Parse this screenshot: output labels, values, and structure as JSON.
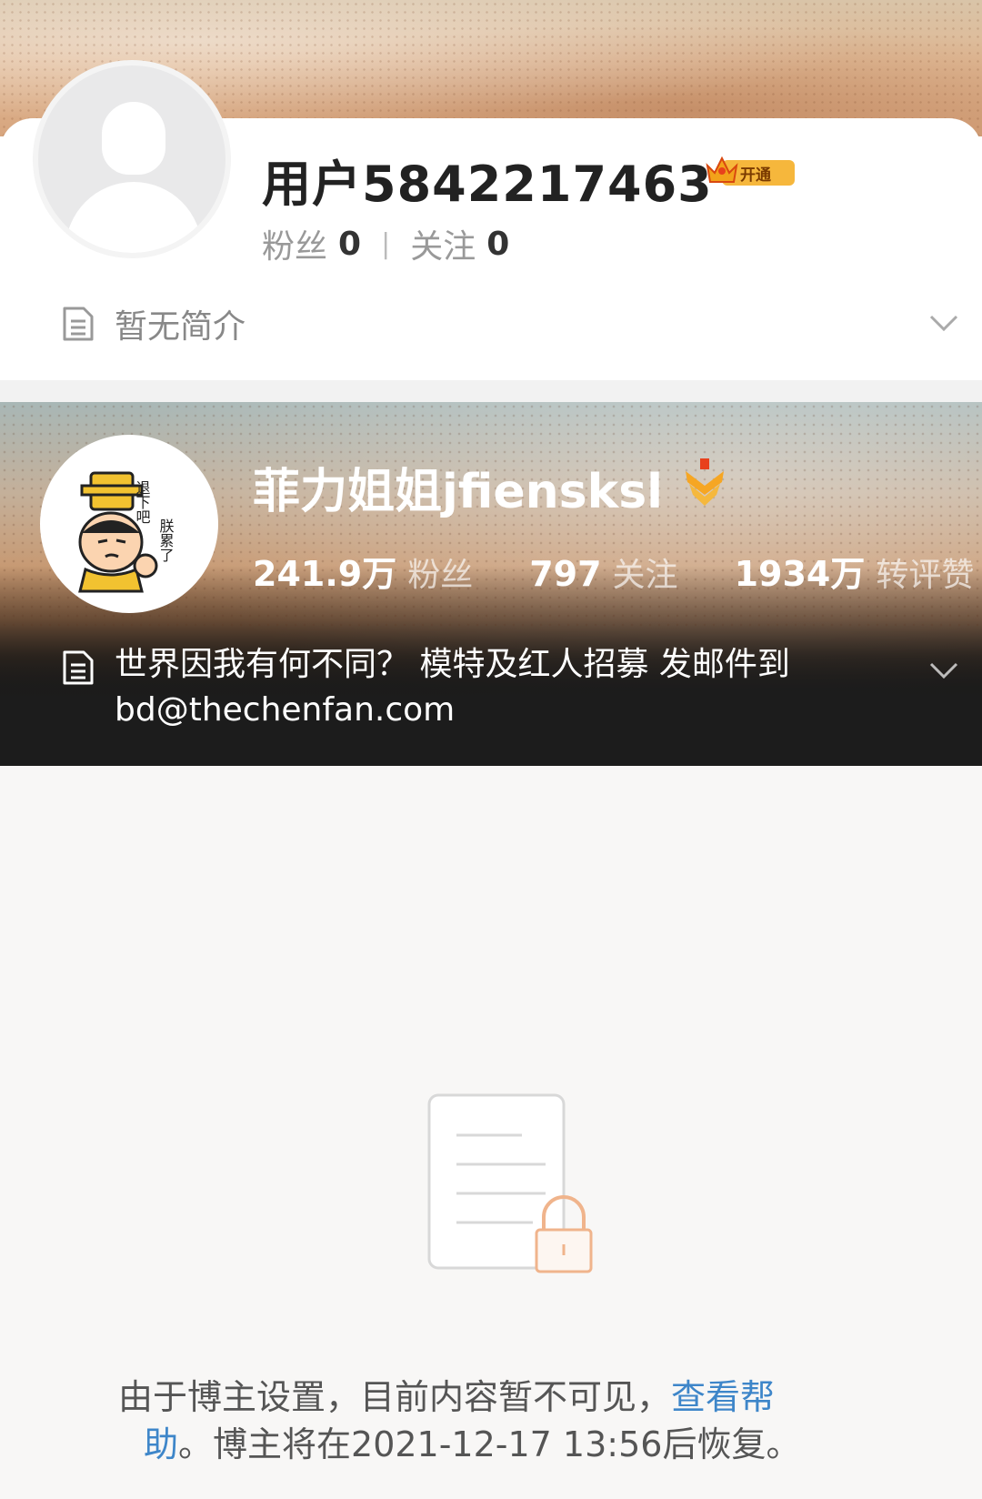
{
  "own_profile": {
    "username": "用户5842217463",
    "vip_badge_text": "开通",
    "followers_label": "粉丝",
    "followers_count": "0",
    "separator": "|",
    "following_label": "关注",
    "following_count": "0",
    "bio": "暂无简介"
  },
  "target_profile": {
    "username": "菲力姐姐jfiensksl",
    "stats": [
      {
        "value": "241.9万",
        "label": "粉丝"
      },
      {
        "value": "797",
        "label": "关注"
      },
      {
        "value": "1934万",
        "label": "转评赞"
      }
    ],
    "bio": "世界因我有何不同？ 模特及红人招募 发邮件到 bd@thechenfan.com",
    "bio_line1": "世界因我有何不同？ 模特及红人招募 发邮件到",
    "bio_line2": "bd@thechenfan.com",
    "avatar_text": [
      "退下吧",
      "朕累了"
    ]
  },
  "locked_notice": {
    "text_before_link": "由于博主设置，目前内容暂不可见，",
    "link_part1": "查看帮",
    "link_part2": "助",
    "text_after_link": "。博主将在2021-12-17 13:56后恢复。"
  },
  "colors": {
    "link": "#3e86c9",
    "vip_gold": "#f6b73c",
    "lock_orange": "#f0b48c"
  }
}
